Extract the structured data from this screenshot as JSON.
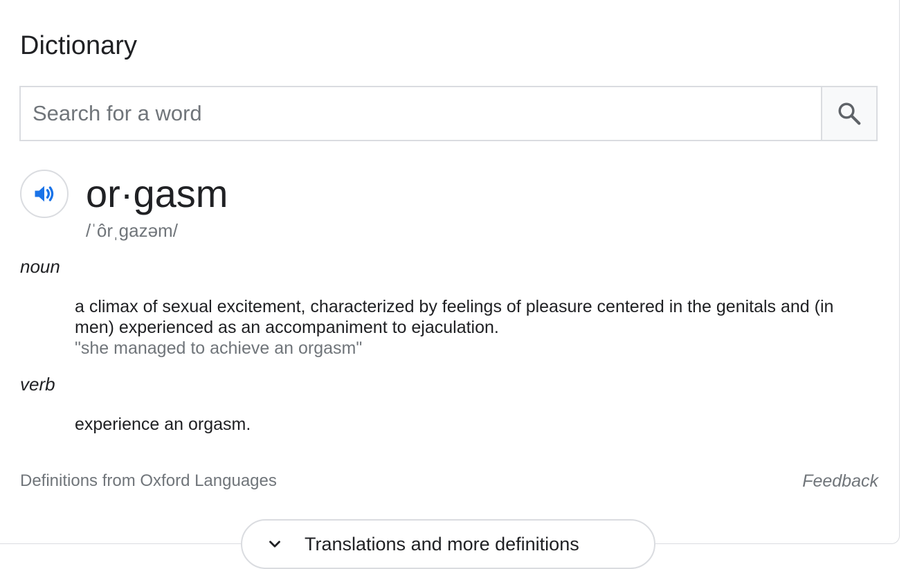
{
  "dictionary": {
    "title": "Dictionary",
    "search": {
      "placeholder": "Search for a word",
      "value": "",
      "button_icon": "search-icon"
    },
    "entry": {
      "speaker_icon": "speaker-icon",
      "headword": "or·gasm",
      "phonetic": "/ˈôrˌɡazəm/",
      "senses": [
        {
          "pos": "noun",
          "definition": "a climax of sexual excitement, characterized by feelings of pleasure centered in the genitals and (in men) experienced as an accompaniment to ejaculation.",
          "example": "\"she managed to achieve an orgasm\""
        },
        {
          "pos": "verb",
          "definition": "experience an orgasm."
        }
      ]
    },
    "source": "Definitions from Oxford Languages",
    "feedback": "Feedback",
    "more_button": {
      "icon": "chevron-down-icon",
      "label": "Translations and more definitions"
    }
  },
  "colors": {
    "accent": "#1a73e8",
    "text_primary": "#202124",
    "text_secondary": "#70757a",
    "border": "#dadce0"
  }
}
